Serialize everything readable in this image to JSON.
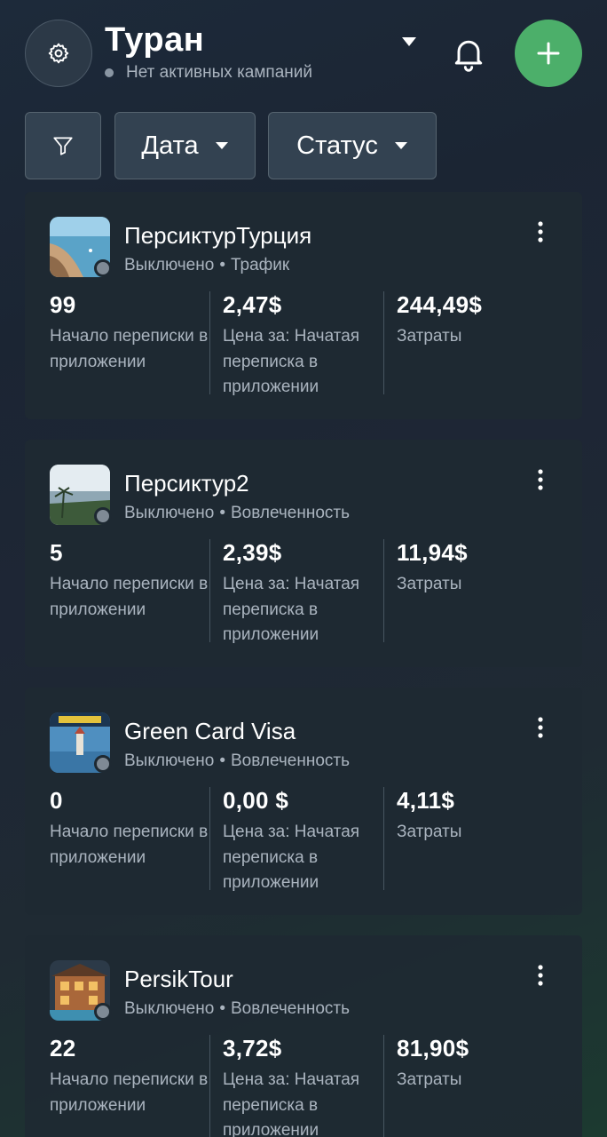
{
  "header": {
    "account_name": "Туран",
    "status_text": "Нет активных кампаний"
  },
  "filters": {
    "date_label": "Дата",
    "status_label": "Статус"
  },
  "campaigns": [
    {
      "name": "ПерсиктурТурция",
      "state": "Выключено",
      "separator": "•",
      "objective": "Трафик",
      "metrics": [
        {
          "value": "99",
          "label": "Начало переписки в приложении"
        },
        {
          "value": "2,47$",
          "label": "Цена за: Начатая переписка в приложении"
        },
        {
          "value": "244,49$",
          "label": "Затраты"
        }
      ]
    },
    {
      "name": "Персиктур2",
      "state": "Выключено",
      "separator": "•",
      "objective": "Вовлеченность",
      "metrics": [
        {
          "value": "5",
          "label": "Начало переписки в приложении"
        },
        {
          "value": "2,39$",
          "label": "Цена за: Начатая переписка в приложении"
        },
        {
          "value": "11,94$",
          "label": "Затраты"
        }
      ]
    },
    {
      "name": "Green Card Visa",
      "state": "Выключено",
      "separator": "•",
      "objective": "Вовлеченность",
      "metrics": [
        {
          "value": "0",
          "label": "Начало переписки в приложении"
        },
        {
          "value": "0,00 $",
          "label": "Цена за: Начатая переписка в приложении"
        },
        {
          "value": "4,11$",
          "label": "Затраты"
        }
      ]
    },
    {
      "name": "PersikTour",
      "state": "Выключено",
      "separator": "•",
      "objective": "Вовлеченность",
      "metrics": [
        {
          "value": "22",
          "label": "Начало переписки в приложении"
        },
        {
          "value": "3,72$",
          "label": "Цена за: Начатая переписка в приложении"
        },
        {
          "value": "81,90$",
          "label": "Затраты"
        }
      ]
    }
  ],
  "colors": {
    "accent_green": "#4caf6a",
    "card_bg": "#1e2932",
    "muted_text": "#aab4bf"
  },
  "icons": {
    "settings": "gear-icon",
    "account_dropdown": "caret-down-icon",
    "notifications": "bell-icon",
    "create": "plus-icon",
    "filter": "funnel-icon",
    "more": "more-vertical-icon"
  }
}
